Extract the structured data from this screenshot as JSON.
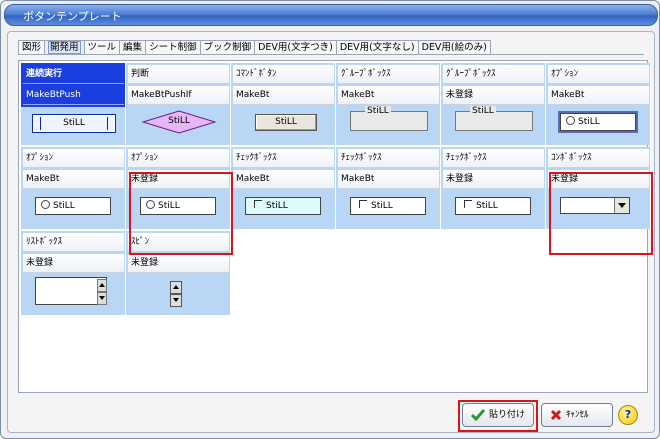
{
  "window": {
    "title": "ボタンテンプレート"
  },
  "tabs": [
    {
      "label": "図形"
    },
    {
      "label": "開発用"
    },
    {
      "label": "ツール"
    },
    {
      "label": "編集"
    },
    {
      "label": "シート制御"
    },
    {
      "label": "ブック制御"
    },
    {
      "label": "DEV用(文字つき)"
    },
    {
      "label": "DEV用(文字なし)"
    },
    {
      "label": "DEV用(絵のみ)"
    }
  ],
  "cards": [
    {
      "title": "連続実行",
      "macro": "MakeBtPush",
      "sample": "StiLL"
    },
    {
      "title": "判断",
      "macro": "MakeBtPushIf",
      "sample": "StiLL"
    },
    {
      "title": "ｺﾏﾝﾄﾞﾎﾞﾀﾝ",
      "macro": "MakeBt",
      "sample": "StiLL"
    },
    {
      "title": "ｸﾞﾙｰﾌﾟﾎﾞｯｸｽ",
      "macro": "MakeBt",
      "sample": "StiLL"
    },
    {
      "title": "ｸﾞﾙｰﾌﾟﾎﾞｯｸｽ",
      "macro": "未登録",
      "sample": "StiLL"
    },
    {
      "title": "ｵﾌﾟｼｮﾝ",
      "macro": "MakeBt",
      "sample": "StiLL"
    },
    {
      "title": "ｵﾌﾟｼｮﾝ",
      "macro": "MakeBt",
      "sample": "StiLL"
    },
    {
      "title": "ｵﾌﾟｼｮﾝ",
      "macro": "未登録",
      "sample": "StiLL"
    },
    {
      "title": "ﾁｪｯｸﾎﾞｯｸｽ",
      "macro": "MakeBt",
      "sample": "StiLL"
    },
    {
      "title": "ﾁｪｯｸﾎﾞｯｸｽ",
      "macro": "MakeBt",
      "sample": "StiLL"
    },
    {
      "title": "ﾁｪｯｸﾎﾞｯｸｽ",
      "macro": "未登録",
      "sample": "StiLL"
    },
    {
      "title": "ｺﾝﾎﾞﾎﾞｯｸｽ",
      "macro": "未登録",
      "sample": ""
    },
    {
      "title": "ﾘｽﾄﾎﾞｯｸｽ",
      "macro": "未登録",
      "sample": ""
    },
    {
      "title": "ｽﾋﾟﾝ",
      "macro": "未登録",
      "sample": ""
    }
  ],
  "footer": {
    "paste_label": "貼り付け",
    "cancel_label": "ｷｬﾝｾﾙ",
    "help_label": "?"
  },
  "colors": {
    "card_bg": "#b9d6f4",
    "selected": "#1a3ee0",
    "highlight": "#d8141e"
  }
}
